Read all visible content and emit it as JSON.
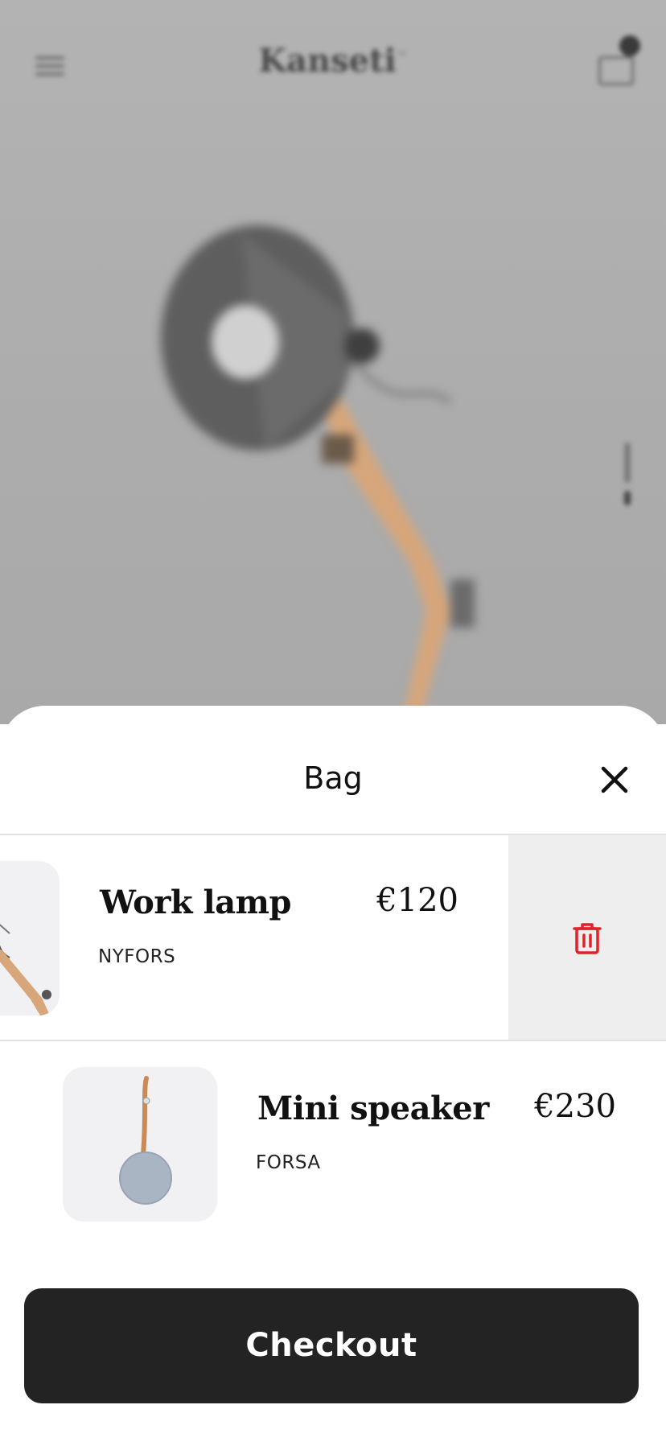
{
  "background": {
    "brand_logo": "Kanseti",
    "brand_logo_mark": "™",
    "menu_icon": "hamburger-menu-icon",
    "bag_icon": "shopping-bag-icon"
  },
  "bag": {
    "title": "Bag",
    "close_icon": "close-icon",
    "items": [
      {
        "name": "Work lamp",
        "brand": "NYFORS",
        "price": "€120",
        "swiped": true,
        "delete_icon": "trash-icon"
      },
      {
        "name": "Mini speaker",
        "brand": "FORSA",
        "price": "€230",
        "swiped": false
      }
    ],
    "checkout_label": "Checkout"
  },
  "colors": {
    "checkout_bg": "#232323",
    "delete_bg": "#eeeeee",
    "delete_icon": "#e0232b",
    "sheet_bg": "#ffffff"
  }
}
